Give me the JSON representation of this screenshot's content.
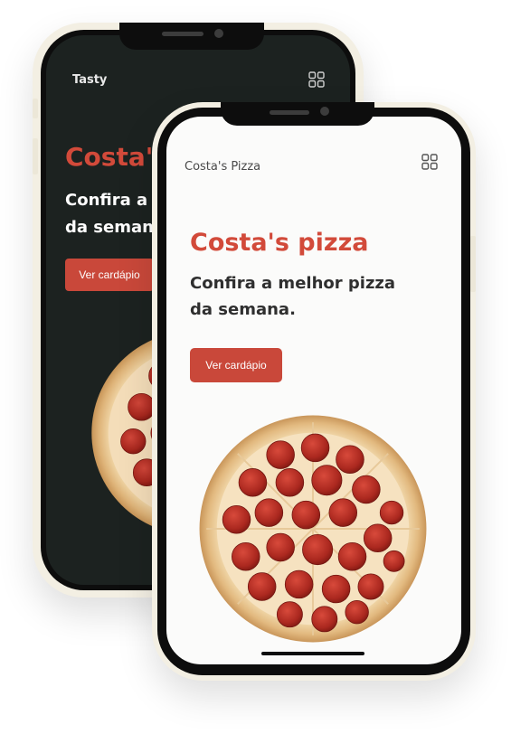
{
  "back_phone": {
    "brand": "Tasty",
    "hero_title": "Costa's pizza",
    "hero_subtitle_line1": "Confira a melhor pizza",
    "hero_subtitle_line2": "da semana.",
    "cta_label": "Ver cardápio",
    "menu_icon": "grid-icon",
    "colors": {
      "background": "#1c2220",
      "accent": "#d24a3a",
      "text": "#ffffff"
    }
  },
  "front_phone": {
    "brand": "Costa's Pizza",
    "hero_title": "Costa's pizza",
    "hero_subtitle_line1": "Confira a melhor pizza",
    "hero_subtitle_line2": "da semana.",
    "cta_label": "Ver cardápio",
    "menu_icon": "grid-icon",
    "colors": {
      "background": "#fbfbfa",
      "accent": "#d24a3a",
      "text": "#2f2f2f"
    }
  }
}
